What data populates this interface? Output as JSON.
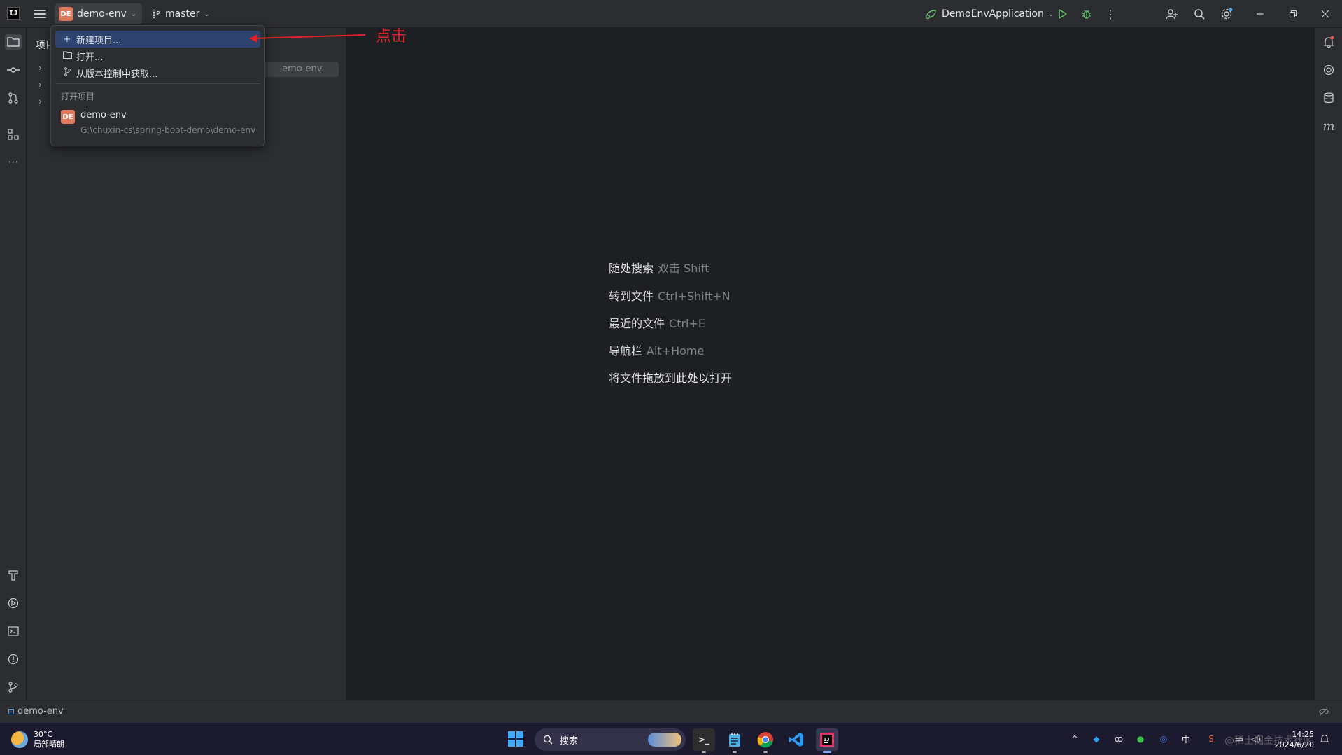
{
  "titlebar": {
    "logo_text": "IJ",
    "project_badge": "DE",
    "project_name": "demo-env",
    "branch_name": "master",
    "run_config": "DemoEnvApplication",
    "icons": [
      "hamburger-menu-icon",
      "git-branch-icon",
      "run-icon",
      "debug-icon",
      "more-icon",
      "add-user-icon",
      "search-icon",
      "settings-icon",
      "minimize-icon",
      "restore-icon",
      "close-icon"
    ]
  },
  "left_strip": {
    "icons": [
      "project-icon",
      "commit-icon",
      "pull-requests-icon",
      "structure-icon",
      "more-tools-icon",
      "build-icon",
      "services-icon",
      "terminal-icon",
      "problems-icon",
      "git-icon"
    ]
  },
  "project_panel": {
    "title": "项目",
    "chip_text": "emo-env"
  },
  "menu": {
    "items": [
      {
        "icon": "plus-icon",
        "label": "新建项目..."
      },
      {
        "icon": "folder-icon",
        "label": "打开..."
      },
      {
        "icon": "vcs-icon",
        "label": "从版本控制中获取..."
      }
    ],
    "group_label": "打开项目",
    "recent": {
      "badge": "DE",
      "name": "demo-env",
      "path": "G:\\chuxin-cs\\spring-boot-demo\\demo-env"
    }
  },
  "annotation": {
    "text": "点击",
    "color": "#e0202a"
  },
  "editor": {
    "hints": [
      {
        "label": "随处搜索",
        "shortcut": "双击 Shift"
      },
      {
        "label": "转到文件",
        "shortcut": "Ctrl+Shift+N"
      },
      {
        "label": "最近的文件",
        "shortcut": "Ctrl+E"
      },
      {
        "label": "导航栏",
        "shortcut": "Alt+Home"
      },
      {
        "label": "将文件拖放到此处以打开",
        "shortcut": ""
      }
    ]
  },
  "right_strip": {
    "icons": [
      "notifications-icon",
      "ai-assistant-icon",
      "database-icon",
      "maven-icon"
    ]
  },
  "statusbar": {
    "project": "demo-env"
  },
  "taskbar": {
    "weather_temp": "30°C",
    "weather_desc": "局部晴朗",
    "search_placeholder": "搜索",
    "tray_lang": "中",
    "time": "14:25",
    "date": "2024/6/20",
    "watermark": "@稀土掘金技术社区",
    "colors": {
      "accent": "#3fa9f5",
      "background": "#1c1a2e"
    }
  }
}
